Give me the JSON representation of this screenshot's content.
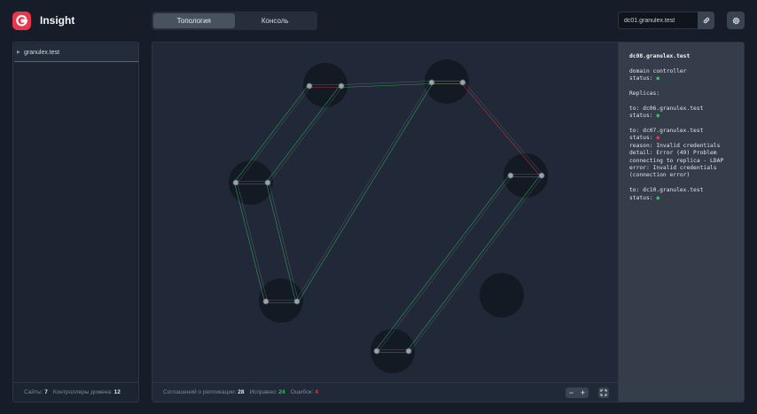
{
  "app": {
    "title": "Insight"
  },
  "tabs": [
    {
      "label": "Топология",
      "active": true
    },
    {
      "label": "Консоль",
      "active": false
    }
  ],
  "header": {
    "host_value": "dc01.granulex.test"
  },
  "icons": {
    "logo": "logo-icon",
    "link": "link-icon",
    "settings": "gear-icon",
    "tree_arrow": "caret-right-icon",
    "zoom_out": "minus-icon",
    "zoom_in": "plus-icon",
    "fit": "fit-screen-icon"
  },
  "colors": {
    "accent": "#e8364a",
    "ok": "#2ec35e",
    "error": "#e8364a"
  },
  "sidebar": {
    "items": [
      {
        "label": "granulex.test",
        "expanded": false
      }
    ],
    "footer": {
      "sites_label": "Сайты:",
      "sites_value": "7",
      "dc_label": "Контроллеры домена:",
      "dc_value": "12"
    }
  },
  "canvas_footer": {
    "agreements_label": "Соглашений о репликации:",
    "agreements_value": "28",
    "ok_label": "Исправно:",
    "ok_value": "24",
    "err_label": "Ошибок:",
    "err_value": "4"
  },
  "zoom": {
    "out_label": "−",
    "in_label": "+"
  },
  "details": {
    "lines": [
      {
        "text": "dc08.granulex.test",
        "style": "heading"
      },
      {
        "text": ""
      },
      {
        "text": "domain controller"
      },
      {
        "text": "status: ",
        "dot": "ok"
      },
      {
        "text": ""
      },
      {
        "text": "Replicas:"
      },
      {
        "text": ""
      },
      {
        "text": "to: dc06.granulex.test"
      },
      {
        "text": "status: ",
        "dot": "ok"
      },
      {
        "text": ""
      },
      {
        "text": "to: dc07.granulex.test"
      },
      {
        "text": "status: ",
        "dot": "err"
      },
      {
        "text": "reason: Invalid credentials"
      },
      {
        "text": "detail: Error (49) Problem"
      },
      {
        "text": "connecting to replica - LDAP"
      },
      {
        "text": "error: Invalid credentials"
      },
      {
        "text": "(connection error)"
      },
      {
        "text": ""
      },
      {
        "text": "to: dc10.granulex.test"
      },
      {
        "text": "status: ",
        "dot": "ok"
      }
    ]
  },
  "topology": {
    "sites": [
      {
        "id": "site-1",
        "nodes": [
          "n1",
          "n2"
        ]
      },
      {
        "id": "site-2",
        "nodes": [
          "n3",
          "n4"
        ]
      },
      {
        "id": "site-3",
        "nodes": [
          "n5",
          "n6"
        ]
      },
      {
        "id": "site-4",
        "nodes": [
          "n7",
          "n8"
        ]
      },
      {
        "id": "site-5",
        "nodes": [
          "n9",
          "n10"
        ]
      },
      {
        "id": "site-6",
        "nodes": [
          "n11",
          "n12"
        ]
      },
      {
        "id": "site-7",
        "nodes": []
      }
    ],
    "links": [
      {
        "from": "n1",
        "to": "n2",
        "status": "error"
      },
      {
        "from": "n3",
        "to": "n4",
        "status": "error"
      },
      {
        "from": "n5",
        "to": "n6",
        "status": "ok"
      },
      {
        "from": "n7",
        "to": "n8",
        "status": "ok"
      },
      {
        "from": "n9",
        "to": "n10",
        "status": "ok"
      },
      {
        "from": "n11",
        "to": "n12",
        "status": "ok"
      },
      {
        "from": "n2",
        "to": "n3",
        "status": "ok"
      },
      {
        "from": "n1",
        "to": "n5",
        "status": "ok"
      },
      {
        "from": "n2",
        "to": "n6",
        "status": "ok"
      },
      {
        "from": "n5",
        "to": "n9",
        "status": "ok"
      },
      {
        "from": "n6",
        "to": "n10",
        "status": "ok"
      },
      {
        "from": "n10",
        "to": "n3",
        "status": "ok"
      },
      {
        "from": "n4",
        "to": "n8",
        "status": "error"
      },
      {
        "from": "n7",
        "to": "n11",
        "status": "ok"
      },
      {
        "from": "n8",
        "to": "n12",
        "status": "ok"
      },
      {
        "from": "n3",
        "to": "n4",
        "status": "ok"
      }
    ]
  }
}
